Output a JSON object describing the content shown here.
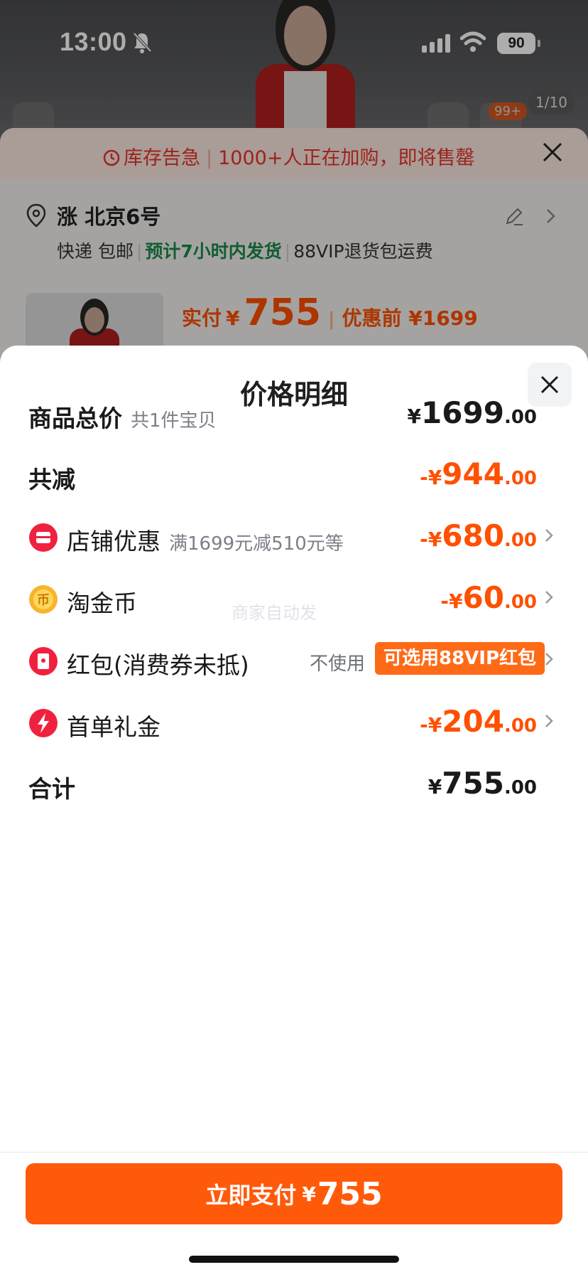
{
  "status_bar": {
    "time": "13:00",
    "battery": "90"
  },
  "background": {
    "cart_badge": "99+",
    "image_counter": "1/10",
    "stock_alert": {
      "title": "库存告急",
      "message": "1000+人正在加购，即将售罄"
    },
    "address": {
      "name": "涨 北京6号"
    },
    "shipping": {
      "method": "快递 包邮",
      "dispatch": "预计7小时内发货",
      "return": "88VIP退货包运费"
    },
    "price": {
      "label": "实付",
      "currency": "¥",
      "amount": "755",
      "original": "优惠前 ¥1699"
    }
  },
  "sheet": {
    "title": "价格明细",
    "rows": [
      {
        "label": "商品总价",
        "sub": "共1件宝贝",
        "cur": "¥",
        "int": "1699",
        "dec": ".00",
        "tone": "dark"
      },
      {
        "label": "共减",
        "cur": "-¥",
        "int": "944",
        "dec": ".00",
        "tone": "orange"
      },
      {
        "label": "店铺优惠",
        "sub": "满1699元减510元等",
        "cur": "-¥",
        "int": "680",
        "dec": ".00",
        "tone": "orange",
        "icon": "store-icon"
      },
      {
        "label": "淘金币",
        "cur": "-¥",
        "int": "60",
        "dec": ".00",
        "tone": "orange",
        "icon": "coin-icon"
      },
      {
        "label": "红包(消费券未抵)",
        "not_use": "不使用",
        "vip_button": "可选用88VIP红包",
        "icon": "red-packet-icon"
      },
      {
        "label": "首单礼金",
        "cur": "-¥",
        "int": "204",
        "dec": ".00",
        "tone": "orange",
        "icon": "lightning-icon"
      },
      {
        "label": "合计",
        "cur": "¥",
        "int": "755",
        "dec": ".00",
        "tone": "dark"
      }
    ],
    "watermark": "商家自动发"
  },
  "pay_button": {
    "label": "立即支付",
    "currency": "¥",
    "amount": "755"
  },
  "colors": {
    "accent": "#ff5000",
    "button": "#ff5a0a",
    "green": "#1a8a4a"
  }
}
